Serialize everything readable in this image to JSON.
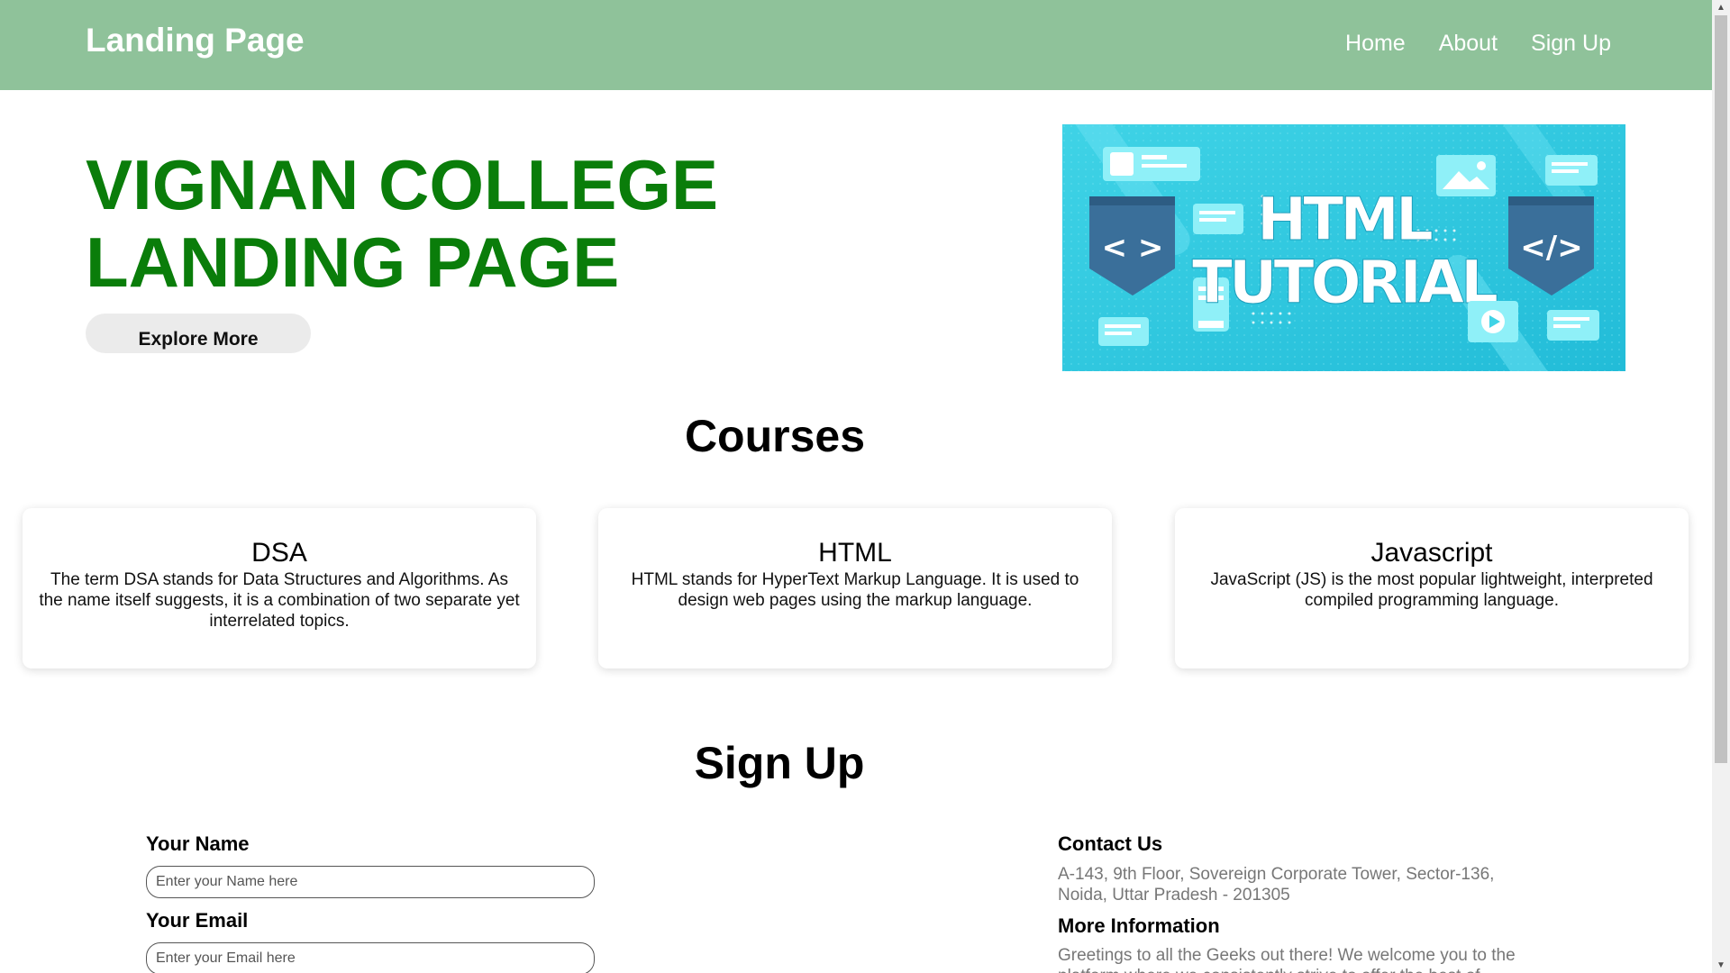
{
  "navbar": {
    "brand": "Landing Page",
    "links": [
      "Home",
      "About",
      "Sign Up"
    ],
    "background": "#8fc29a"
  },
  "hero": {
    "title_line1": "VIGNAN COLLEGE",
    "title_line2": "LANDING PAGE",
    "title_color": "#0a7d0a",
    "button_label": "Explore More",
    "image": {
      "line1": "HTML",
      "line2": "TUTORIAL",
      "left_badge": "< >",
      "right_badge": "</>"
    }
  },
  "courses": {
    "title": "Courses",
    "items": [
      {
        "name": "DSA",
        "description": "The term DSA stands for Data Structures and Algorithms. As the name itself suggests, it is a combination of two separate yet interrelated topics."
      },
      {
        "name": "HTML",
        "description": "HTML stands for HyperText Markup Language. It is used to design web pages using the markup language."
      },
      {
        "name": "Javascript",
        "description": "JavaScript (JS) is the most popular lightweight, interpreted compiled programming language."
      }
    ]
  },
  "signup": {
    "title": "Sign Up",
    "name_label": "Your Name",
    "name_placeholder": "Enter your Name here",
    "email_label": "Your Email",
    "email_placeholder": "Enter your Email here"
  },
  "contact": {
    "heading": "Contact Us",
    "address": "A-143, 9th Floor, Sovereign Corporate Tower, Sector-136, Noida, Uttar Pradesh - 201305",
    "more_heading": "More Information",
    "more_text": "Greetings to all the Geeks out there! We welcome you to the platform where we consistently strive to offer the best of"
  }
}
